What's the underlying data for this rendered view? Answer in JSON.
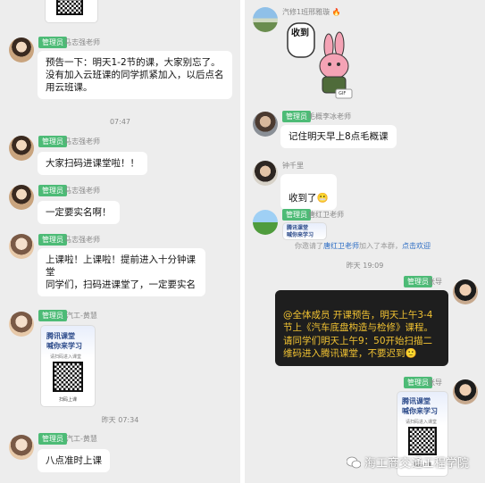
{
  "left": {
    "messages": [
      {
        "badge": "管理员",
        "sender": "马志强老师",
        "text": "预告一下：明天1-2节的课，大家别忘了。\n没有加入云班课的同学抓紧加入，以后点名用云班课。"
      },
      {
        "badge": "管理员",
        "sender": "马志强老师",
        "text": "大家扫码进课堂啦！！"
      },
      {
        "badge": "管理员",
        "sender": "马志强老师",
        "text": "一定要实名啊！"
      },
      {
        "badge": "管理员",
        "sender": "马志强老师",
        "text": "上课啦！上课啦！提前进入十分钟课堂\n同学们，扫码进课堂了，一定要实名"
      },
      {
        "badge": "管理员",
        "sender": "汽工-黄慧",
        "text": ""
      },
      {
        "badge": "管理员",
        "sender": "汽工-黄慧",
        "text": "八点准时上课"
      }
    ],
    "times": [
      "07:47",
      "昨天 07:34"
    ],
    "qr_card": {
      "title": "腾讯课堂\n喊你来学习",
      "subtitle": "请扫码进入课堂",
      "footer": "扫码上课"
    }
  },
  "right": {
    "top_sender": "汽修1班邢雅璇",
    "top_sender_emoji": "🔥",
    "sticker_text": "收到",
    "sticker_tag": "GIF",
    "messages": [
      {
        "badge": "管理员",
        "sender": "毛概李冰老师",
        "text": "记住明天早上8点毛概课"
      },
      {
        "badge": "",
        "sender": "钟千里",
        "text": "收到了"
      },
      {
        "badge": "管理员",
        "sender": "唐红卫老师",
        "text": ""
      },
      {
        "badge": "管理员",
        "sender": "张导",
        "text": "@全体成员 开课预告，明天上午3-4节上《汽车底盘构造与检修》课程。请同学们明天上午9：50开始扫描二维码进入腾讯课堂，不要迟到"
      },
      {
        "badge": "管理员",
        "sender": "张导",
        "text": ""
      }
    ],
    "emoji": {
      "smile": "🙂",
      "grin": "😬"
    },
    "system_note": {
      "prefix": "你邀请了",
      "name": "唐红卫老师",
      "middle": "加入了本群，",
      "action": "点击欢迎"
    },
    "time": "昨天 19:09",
    "qr_card": {
      "title": "腾讯课堂\n喊你来学习",
      "subtitle": "请扫码进入课堂",
      "footer": "扫码上课"
    },
    "mini_card": {
      "title": "腾讯课堂\n喊你来学习"
    }
  },
  "watermark": {
    "text": "海工商交通工程学院"
  },
  "colors": {
    "badge": "#4dbb76",
    "dark_bubble": "#1e1e1e",
    "dark_text": "#f1c232",
    "panel_bg": "#ededed"
  }
}
